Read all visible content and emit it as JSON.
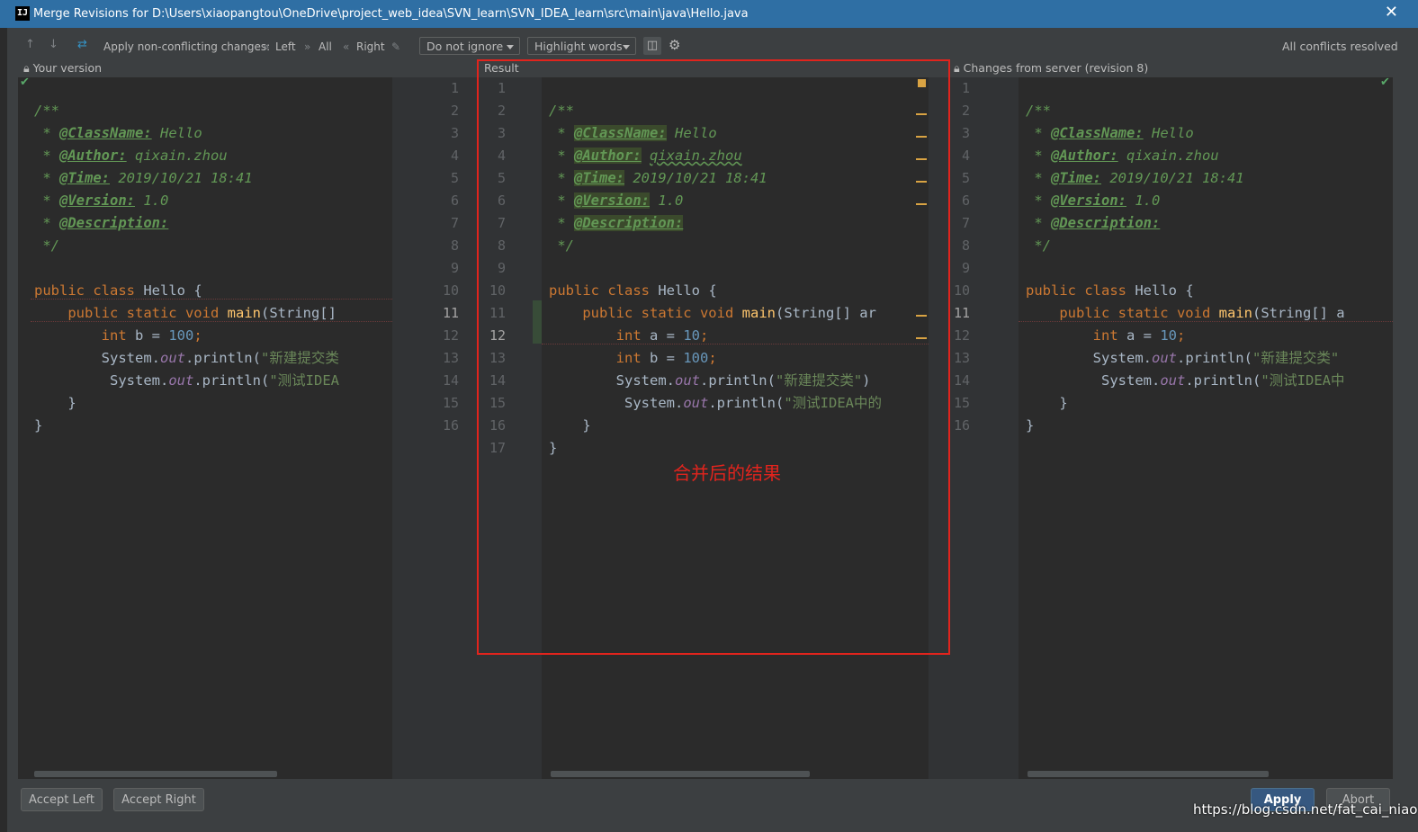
{
  "window": {
    "title": "Merge Revisions for D:\\Users\\xiaopangtou\\OneDrive\\project_web_idea\\SVN_learn\\SVN_IDEA_learn\\src\\main\\java\\Hello.java",
    "app_icon": "IJ",
    "close_glyph": "✕"
  },
  "toolbar": {
    "apply_label": "Apply non-conflicting changes:",
    "left_label": "Left",
    "all_label": "All",
    "right_label": "Right",
    "ignore_select": "Do not ignore",
    "highlight_select": "Highlight words",
    "status": "All conflicts resolved"
  },
  "panes": {
    "left_title": "Your version",
    "middle_title": "Result",
    "right_title": "Changes from server (revision 8)"
  },
  "code": {
    "left": [
      "/**",
      " * @ClassName: Hello",
      " * @Author: qixain.zhou",
      " * @Time: 2019/10/21 18:41",
      " * @Version: 1.0",
      " * @Description:",
      " */",
      "",
      "public class Hello {",
      "    public static void main(String[]",
      "        int b = 100;",
      "        System.out.println(\"新建提交类",
      "         System.out.println(\"测试IDEA",
      "    }",
      "}"
    ],
    "middle": [
      "/**",
      " * @ClassName: Hello",
      " * @Author: qixain.zhou",
      " * @Time: 2019/10/21 18:41",
      " * @Version: 1.0",
      " * @Description:",
      " */",
      "",
      "public class Hello {",
      "    public static void main(String[] ar",
      "        int a = 10;",
      "        int b = 100;",
      "        System.out.println(\"新建提交类\")",
      "         System.out.println(\"测试IDEA中的",
      "    }",
      "}",
      ""
    ],
    "right": [
      "/**",
      " * @ClassName: Hello",
      " * @Author: qixain.zhou",
      " * @Time: 2019/10/21 18:41",
      " * @Version: 1.0",
      " * @Description:",
      " */",
      "",
      "public class Hello {",
      "    public static void main(String[] a",
      "        int a = 10;",
      "        System.out.println(\"新建提交类\"",
      "         System.out.println(\"测试IDEA中",
      "    }",
      "}",
      ""
    ]
  },
  "line_numbers": {
    "left_gutter": [
      "1",
      "2",
      "3",
      "4",
      "5",
      "6",
      "7",
      "8",
      "9",
      "10",
      "11",
      "12",
      "13",
      "14",
      "15",
      "16"
    ],
    "middle_gutter": [
      "1",
      "2",
      "3",
      "4",
      "5",
      "6",
      "7",
      "8",
      "9",
      "10",
      "11",
      "12",
      "13",
      "14",
      "15",
      "16",
      "17"
    ],
    "right_gutter": [
      "1",
      "2",
      "3",
      "4",
      "5",
      "6",
      "7",
      "8",
      "9",
      "10",
      "11",
      "12",
      "13",
      "14",
      "15",
      "16"
    ]
  },
  "annotation": "合并后的结果",
  "buttons": {
    "accept_left": "Accept Left",
    "accept_right": "Accept Right",
    "apply": "Apply",
    "abort": "Abort"
  },
  "watermark": "https://blog.csdn.net/fat_cai_niao",
  "colors": {
    "title_bar": "#2f6fa4",
    "editor_bg": "#2b2b2b",
    "keyword": "#cc7832",
    "comment": "#629755",
    "number": "#6897bb",
    "annotation_red": "#e1241d",
    "apply_button": "#365880"
  }
}
